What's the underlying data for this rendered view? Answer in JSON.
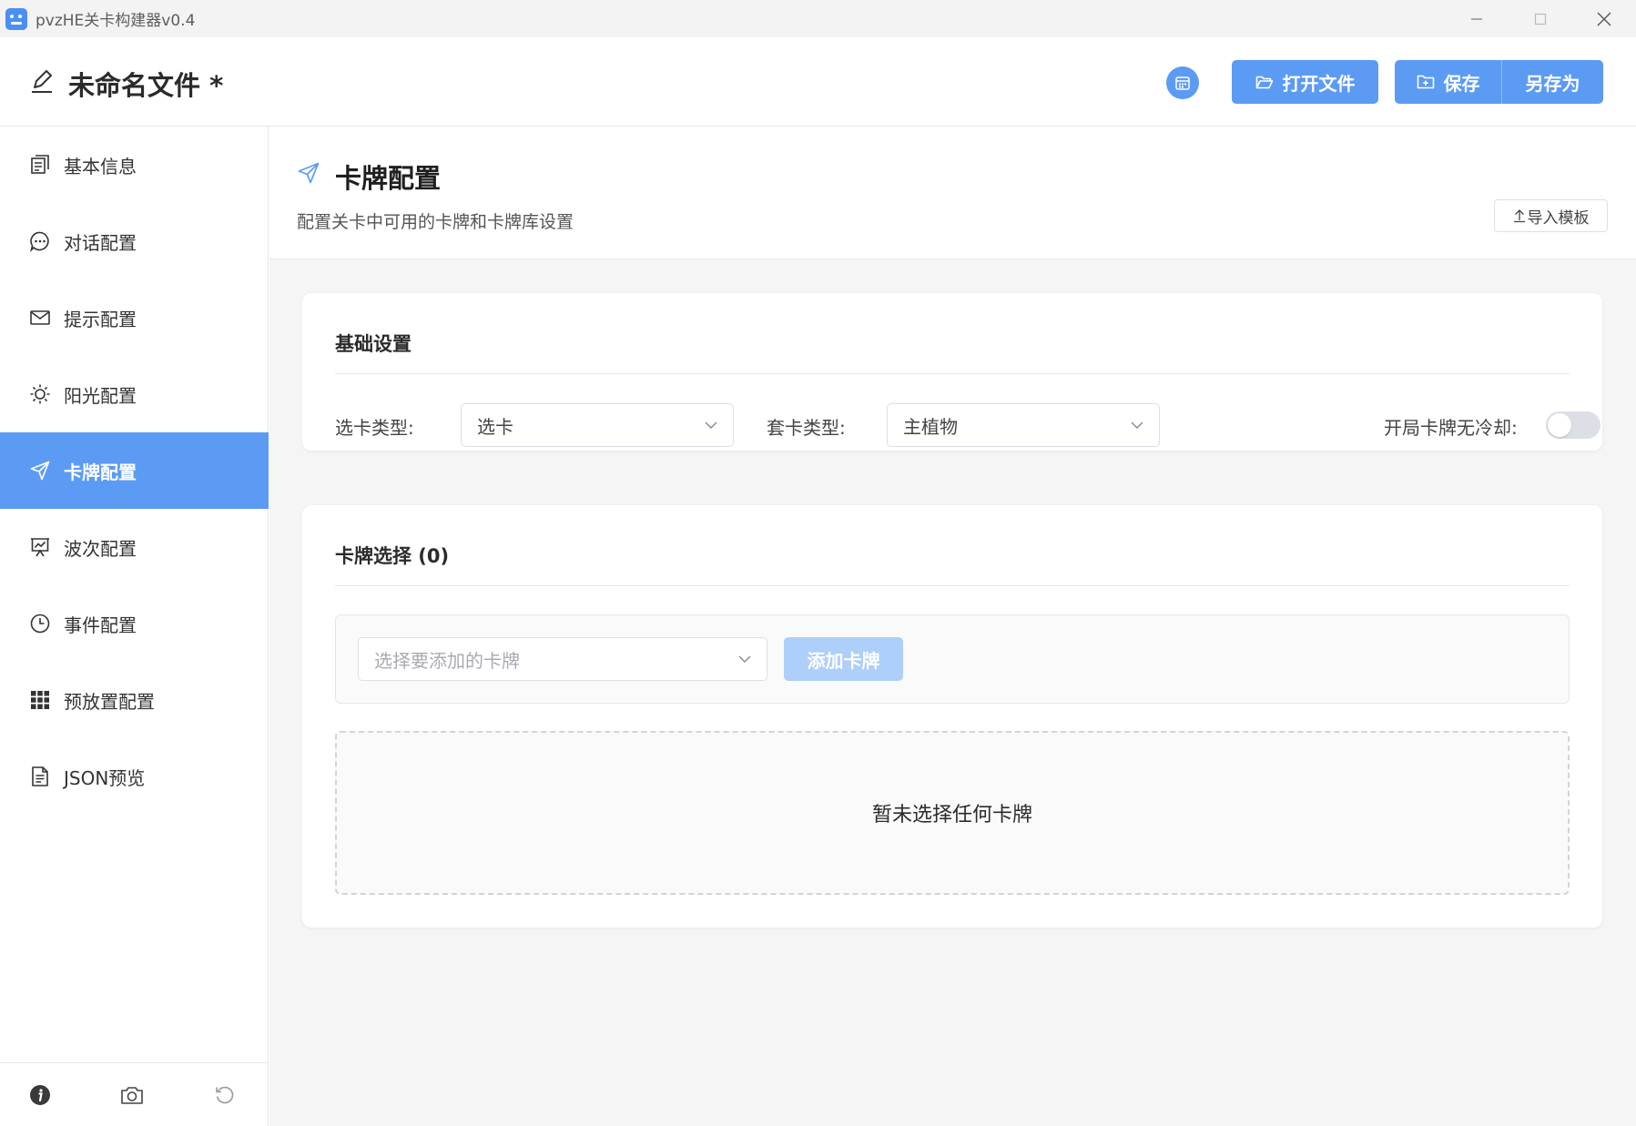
{
  "window": {
    "title": "pvzHE关卡构建器v0.4"
  },
  "header": {
    "doc_title": "未命名文件 *",
    "open_label": "打开文件",
    "save_label": "保存",
    "save_as_label": "另存为"
  },
  "sidebar": {
    "items": [
      {
        "label": "基本信息",
        "icon": "document-icon"
      },
      {
        "label": "对话配置",
        "icon": "chat-icon"
      },
      {
        "label": "提示配置",
        "icon": "mail-icon"
      },
      {
        "label": "阳光配置",
        "icon": "sun-icon"
      },
      {
        "label": "卡牌配置",
        "icon": "send-icon",
        "active": true
      },
      {
        "label": "波次配置",
        "icon": "presentation-icon"
      },
      {
        "label": "事件配置",
        "icon": "clock-icon"
      },
      {
        "label": "预放置配置",
        "icon": "grid-icon"
      },
      {
        "label": "JSON预览",
        "icon": "file-text-icon"
      }
    ],
    "footer_icons": [
      "info-icon",
      "camera-icon",
      "refresh-icon"
    ]
  },
  "page": {
    "title": "卡牌配置",
    "description": "配置关卡中可用的卡牌和卡牌库设置",
    "import_label": "导入模板"
  },
  "basic": {
    "title": "基础设置",
    "pick_type_label": "选卡类型:",
    "pick_type_value": "选卡",
    "set_type_label": "套卡类型:",
    "set_type_value": "主植物",
    "no_cooldown_label": "开局卡牌无冷却:",
    "no_cooldown_enabled": false
  },
  "cards": {
    "title": "卡牌选择 (0)",
    "select_placeholder": "选择要添加的卡牌",
    "add_label": "添加卡牌",
    "empty_text": "暂未选择任何卡牌"
  },
  "colors": {
    "accent": "#5b9bf4",
    "accent_disabled": "#aecff9",
    "background": "#f5f5f5"
  }
}
